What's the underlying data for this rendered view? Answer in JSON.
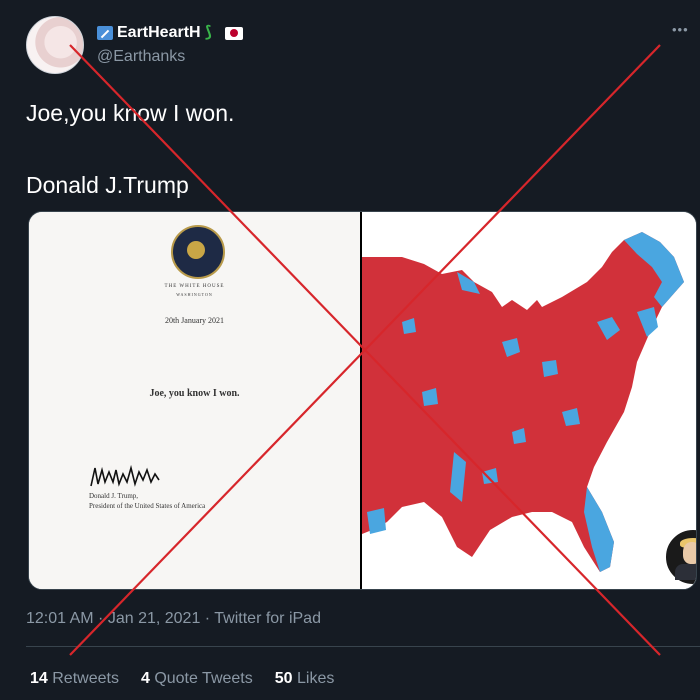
{
  "tweet": {
    "display_name": "EartHeartH",
    "handle": "@Earthanks",
    "more_icon": "more-dots-icon",
    "text_line1": "Joe,you know I won.",
    "text_line2": "Donald J.Trump",
    "timestamp": "12:01 AM · Jan 21, 2021 · Twitter for iPad",
    "stats": {
      "retweets_count": "14",
      "retweets_label": "Retweets",
      "quotes_count": "4",
      "quotes_label": "Quote Tweets",
      "likes_count": "50",
      "likes_label": "Likes"
    }
  },
  "letter": {
    "header_line1": "THE WHITE HOUSE",
    "header_line2": "WASHINGTON",
    "date": "20th January 2021",
    "body": "Joe, you know I won.",
    "signer_name": "Donald J. Trump,",
    "signer_title": "President of the United States of America"
  },
  "colors": {
    "background": "#151b23",
    "cross": "#d7262b",
    "map_red": "#d1313a",
    "map_blue": "#4aa6e0"
  }
}
